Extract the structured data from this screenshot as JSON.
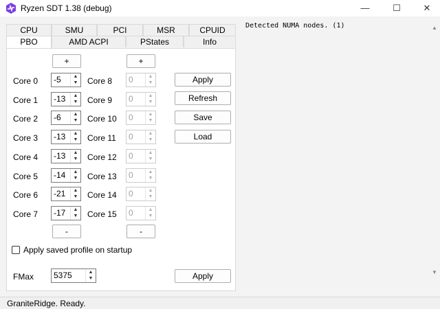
{
  "window": {
    "title": "Ryzen SDT 1.38 (debug)",
    "minimize": "—",
    "maximize": "☐",
    "close": "✕"
  },
  "tabs_row1": [
    "CPU",
    "SMU",
    "PCI",
    "MSR",
    "CPUID"
  ],
  "tabs_row2": [
    "PBO",
    "AMD ACPI",
    "PStates",
    "Info"
  ],
  "pbo": {
    "plus_label": "+",
    "minus_label": "-",
    "cores_left": [
      {
        "label": "Core 0",
        "value": "-5"
      },
      {
        "label": "Core 1",
        "value": "-13"
      },
      {
        "label": "Core 2",
        "value": "-6"
      },
      {
        "label": "Core 3",
        "value": "-13"
      },
      {
        "label": "Core 4",
        "value": "-13"
      },
      {
        "label": "Core 5",
        "value": "-14"
      },
      {
        "label": "Core 6",
        "value": "-21"
      },
      {
        "label": "Core 7",
        "value": "-17"
      }
    ],
    "cores_right": [
      {
        "label": "Core 8",
        "value": "0"
      },
      {
        "label": "Core 9",
        "value": "0"
      },
      {
        "label": "Core 10",
        "value": "0"
      },
      {
        "label": "Core 11",
        "value": "0"
      },
      {
        "label": "Core 12",
        "value": "0"
      },
      {
        "label": "Core 13",
        "value": "0"
      },
      {
        "label": "Core 14",
        "value": "0"
      },
      {
        "label": "Core 15",
        "value": "0"
      }
    ],
    "buttons": {
      "apply": "Apply",
      "refresh": "Refresh",
      "save": "Save",
      "load": "Load"
    },
    "apply_on_startup_label": "Apply saved profile on startup",
    "fmax_label": "FMax",
    "fmax_value": "5375",
    "fmax_apply": "Apply"
  },
  "log": {
    "text": "Detected NUMA nodes. (1)"
  },
  "status": {
    "text": "GraniteRidge. Ready."
  },
  "colors": {
    "app_icon": "#7b3fe4",
    "tab_border": "#d9d9d9",
    "panel_bg": "#ffffff"
  },
  "icons": {
    "app": "app-icon",
    "spin_up": "▲",
    "spin_down": "▼",
    "scroll_up": "▲",
    "scroll_down": "▼"
  }
}
